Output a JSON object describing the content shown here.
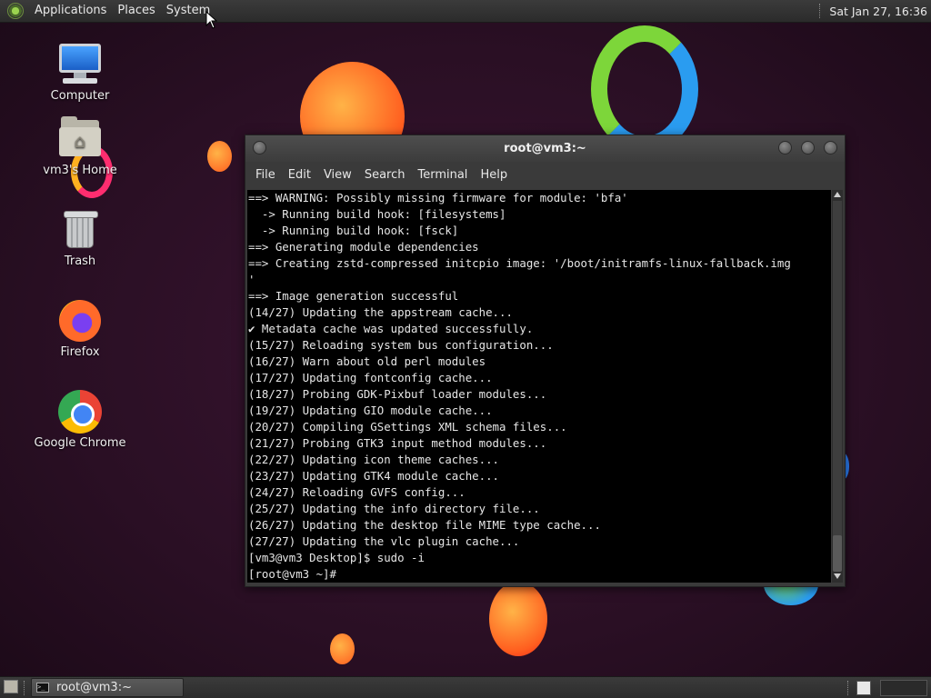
{
  "top_panel": {
    "menus": [
      "Applications",
      "Places",
      "System"
    ],
    "clock": "Sat Jan 27, 16:36"
  },
  "desktop_icons": [
    {
      "label": "Computer",
      "icon": "computer-icon"
    },
    {
      "label": "vm3's Home",
      "icon": "home-folder-icon"
    },
    {
      "label": "Trash",
      "icon": "trash-icon"
    },
    {
      "label": "Firefox",
      "icon": "firefox-icon"
    },
    {
      "label": "Google Chrome",
      "icon": "chrome-icon"
    }
  ],
  "terminal": {
    "title": "root@vm3:~",
    "menu": [
      "File",
      "Edit",
      "View",
      "Search",
      "Terminal",
      "Help"
    ],
    "lines": [
      "==> WARNING: Possibly missing firmware for module: 'bfa'",
      "  -> Running build hook: [filesystems]",
      "  -> Running build hook: [fsck]",
      "==> Generating module dependencies",
      "==> Creating zstd-compressed initcpio image: '/boot/initramfs-linux-fallback.img",
      "'",
      "==> Image generation successful",
      "(14/27) Updating the appstream cache...",
      "✔ Metadata cache was updated successfully.",
      "(15/27) Reloading system bus configuration...",
      "(16/27) Warn about old perl modules",
      "(17/27) Updating fontconfig cache...",
      "(18/27) Probing GDK-Pixbuf loader modules...",
      "(19/27) Updating GIO module cache...",
      "(20/27) Compiling GSettings XML schema files...",
      "(21/27) Probing GTK3 input method modules...",
      "(22/27) Updating icon theme caches...",
      "(23/27) Updating GTK4 module cache...",
      "(24/27) Reloading GVFS config...",
      "(25/27) Updating the info directory file...",
      "(26/27) Updating the desktop file MIME type cache...",
      "(27/27) Updating the vlc plugin cache...",
      "[vm3@vm3 Desktop]$ sudo -i",
      "[root@vm3 ~]#"
    ]
  },
  "taskbar": {
    "tasks": [
      {
        "label": "root@vm3:~",
        "icon": "terminal-icon"
      }
    ],
    "workspaces": 2
  },
  "colors": {
    "wallpaper": "#2a0f24",
    "panel": "#333333",
    "terminal_bg": "#000000",
    "terminal_fg": "#e6e6e6"
  }
}
